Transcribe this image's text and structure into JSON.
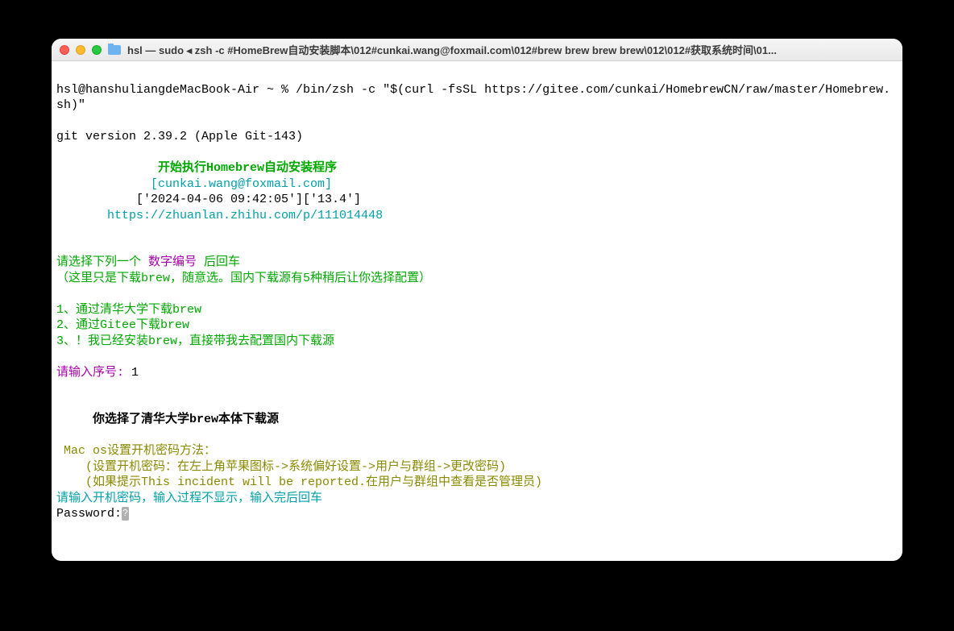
{
  "window": {
    "title": "hsl — sudo ◂ zsh -c #HomeBrew自动安装脚本\\012#cunkai.wang@foxmail.com\\012#brew brew brew brew\\012\\012#获取系统时间\\01..."
  },
  "terminal": {
    "line1": "hsl@hanshuliangdeMacBook-Air ~ % /bin/zsh -c \"$(curl -fsSL https://gitee.com/cunkai/HomebrewCN/raw/master/Homebrew.",
    "line2": "sh)\"",
    "blank1": "",
    "git_version": "git version 2.39.2 (Apple Git-143)",
    "blank2": "",
    "header1": "              开始执行Homebrew自动安装程序",
    "header2": "             [cunkai.wang@foxmail.com]",
    "header3": "           ['2024-04-06 09:42:05']['13.4']",
    "header4": "       https://zhuanlan.zhihu.com/p/111014448",
    "blank3": "",
    "blank4": "",
    "select_prefix": "请选择下列一个 ",
    "select_num": "数字编号",
    "select_suffix": " 后回车",
    "select_note": "（这里只是下载brew，随意选。国内下载源有5种稍后让你选择配置）",
    "blank5": "",
    "opt1": "1、通过清华大学下载brew",
    "opt2": "2、通过Gitee下载brew",
    "opt3": "3、！我已经安装brew，直接带我去配置国内下载源",
    "blank6": "",
    "input_prompt": "请输入序号: ",
    "input_value": "1",
    "blank7": "",
    "blank8": "",
    "choice_prefix": "     ",
    "choice_text": "你选择了清华大学brew本体下载源",
    "blank9": "",
    "mac_hint": " Mac os设置开机密码方法：",
    "mac_hint2": "    (设置开机密码：在左上角苹果图标->系统偏好设置->用户与群组->更改密码)",
    "mac_hint3": "    (如果提示This incident will be reported.在用户与群组中查看是否管理员)",
    "pwd_hint": "请输入开机密码，输入过程不显示，输入完后回车",
    "pwd_label": "Password:"
  }
}
